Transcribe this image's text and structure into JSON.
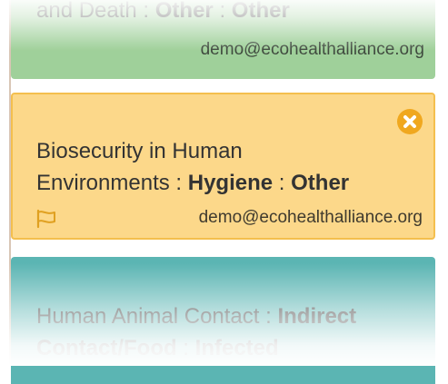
{
  "cards": [
    {
      "title_plain": "and Death : ",
      "category": "Other",
      "separator": " : ",
      "subcategory": "Other",
      "email": "demo@ecohealthalliance.org",
      "color": "#9fd09a"
    },
    {
      "title_line1": "Biosecurity in Human",
      "title_line2_plain": "Environments : ",
      "category": "Hygiene",
      "separator": " : ",
      "subcategory": "Other",
      "email": "demo@ecohealthalliance.org",
      "color": "#fcd88a",
      "close_icon": "close-circle-icon",
      "flag_icon": "flag-icon"
    },
    {
      "title_line1_plain": "Human Animal Contact : ",
      "category_part1": "Indirect",
      "category_part2": "Contact/Food",
      "separator": " : ",
      "subcategory": "Infected",
      "color": "#5bb5b3"
    }
  ]
}
